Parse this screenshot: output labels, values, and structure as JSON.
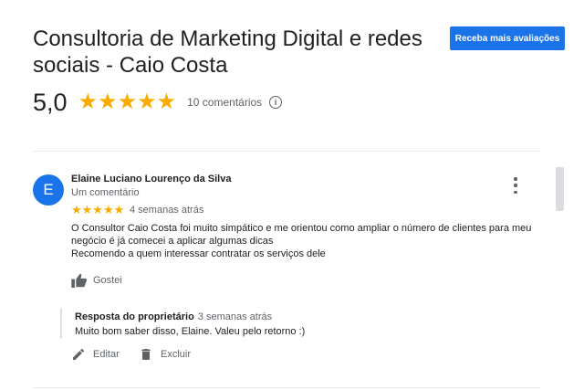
{
  "header": {
    "title": "Consultoria de Marketing Digital e redes sociais - Caio Costa",
    "cta_label": "Receba mais avaliações"
  },
  "summary": {
    "rating": "5,0",
    "stars": "★★★★★",
    "review_count": "10 comentários"
  },
  "review": {
    "avatar_letter": "E",
    "author": "Elaine Luciano Lourenço da Silva",
    "author_sub": "Um comentário",
    "stars": "★★★★★",
    "time": "4 semanas atrás",
    "text_line1": "O Consultor Caio Costa foi muito simpático e me orientou como ampliar o número de clientes para meu negócio é já comecei a aplicar algumas dicas",
    "text_line2": "Recomendo a quem interessar contratar os serviços dele",
    "like_label": "Gostei"
  },
  "reply": {
    "label": "Resposta do proprietário",
    "time": "3 semanas atrás",
    "text": "Muito bom saber disso, Elaine. Valeu pelo retorno :)"
  },
  "actions": {
    "edit_label": "Editar",
    "delete_label": "Excluir"
  },
  "icons": {
    "info": "info-icon",
    "more": "more-vert-icon",
    "like": "thumb-up-icon",
    "edit": "pencil-icon",
    "delete": "trash-icon"
  },
  "colors": {
    "accent": "#1a73e8",
    "star": "#f9ab00"
  }
}
